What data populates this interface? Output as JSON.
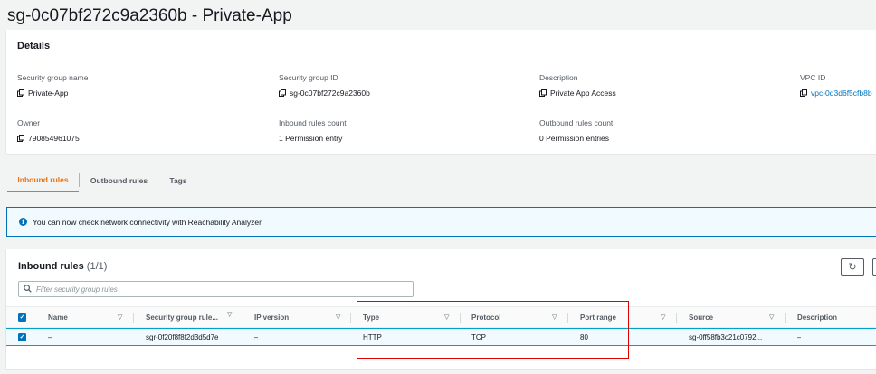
{
  "page": {
    "title": "sg-0c07bf272c9a2360b - Private-App"
  },
  "details": {
    "header": "Details",
    "fields": {
      "sg_name": {
        "label": "Security group name",
        "value": "Private-App"
      },
      "sg_id": {
        "label": "Security group ID",
        "value": "sg-0c07bf272c9a2360b"
      },
      "description": {
        "label": "Description",
        "value": "Private App Access"
      },
      "vpc_id": {
        "label": "VPC ID",
        "value": "vpc-0d3d6f5cfb8b"
      },
      "owner": {
        "label": "Owner",
        "value": "790854961075"
      },
      "inbound_count": {
        "label": "Inbound rules count",
        "value": "1 Permission entry"
      },
      "outbound_count": {
        "label": "Outbound rules count",
        "value": "0 Permission entries"
      }
    }
  },
  "tabs": [
    {
      "label": "Inbound rules",
      "active": true
    },
    {
      "label": "Outbound rules",
      "active": false
    },
    {
      "label": "Tags",
      "active": false
    }
  ],
  "banner": {
    "text": "You can now check network connectivity with Reachability Analyzer"
  },
  "rules": {
    "title": "Inbound rules",
    "count": "(1/1)",
    "search_placeholder": "Filter security group rules",
    "columns": {
      "name": "Name",
      "rule_id": "Security group rule...",
      "ip_version": "IP version",
      "type": "Type",
      "protocol": "Protocol",
      "port_range": "Port range",
      "source": "Source",
      "description": "Description"
    },
    "row": {
      "name": "–",
      "rule_id": "sgr-0f20f8f8f2d3d5d7e",
      "ip_version": "–",
      "type": "HTTP",
      "protocol": "TCP",
      "port_range": "80",
      "source": "sg-0ff58fb3c21c0792...",
      "description": "–"
    }
  },
  "colors": {
    "accent": "#ec7211",
    "link": "#0073bb",
    "highlight": "#e00000"
  }
}
